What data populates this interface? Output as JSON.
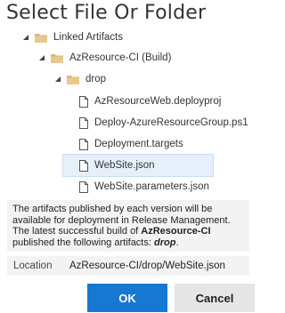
{
  "dialog": {
    "title": "Select File Or Folder"
  },
  "tree": {
    "root": {
      "label": "Linked Artifacts",
      "expanded": true
    },
    "build": {
      "label": "AzResource-CI (Build)",
      "expanded": true
    },
    "folder": {
      "label": "drop",
      "expanded": true
    },
    "files": [
      {
        "label": "AzResourceWeb.deployproj",
        "selected": false
      },
      {
        "label": "Deploy-AzureResourceGroup.ps1",
        "selected": false
      },
      {
        "label": "Deployment.targets",
        "selected": false
      },
      {
        "label": "WebSite.json",
        "selected": true
      },
      {
        "label": "WebSite.parameters.json",
        "selected": false
      }
    ]
  },
  "info": {
    "line1": "The artifacts published by each version will be",
    "line2": "available for deployment in Release Management.",
    "line3_pre": "The latest successful build of ",
    "line3_bold": "AzResource-CI",
    "line4_pre": "published the following artifacts: ",
    "line4_emph": "drop",
    "line4_post": "."
  },
  "location": {
    "label": "Location",
    "value": "AzResource-CI/drop/WebSite.json"
  },
  "buttons": {
    "ok": "OK",
    "cancel": "Cancel"
  },
  "colors": {
    "accent": "#1778d2",
    "selection": "#e6f0fb",
    "folder": "#dcb67a"
  }
}
